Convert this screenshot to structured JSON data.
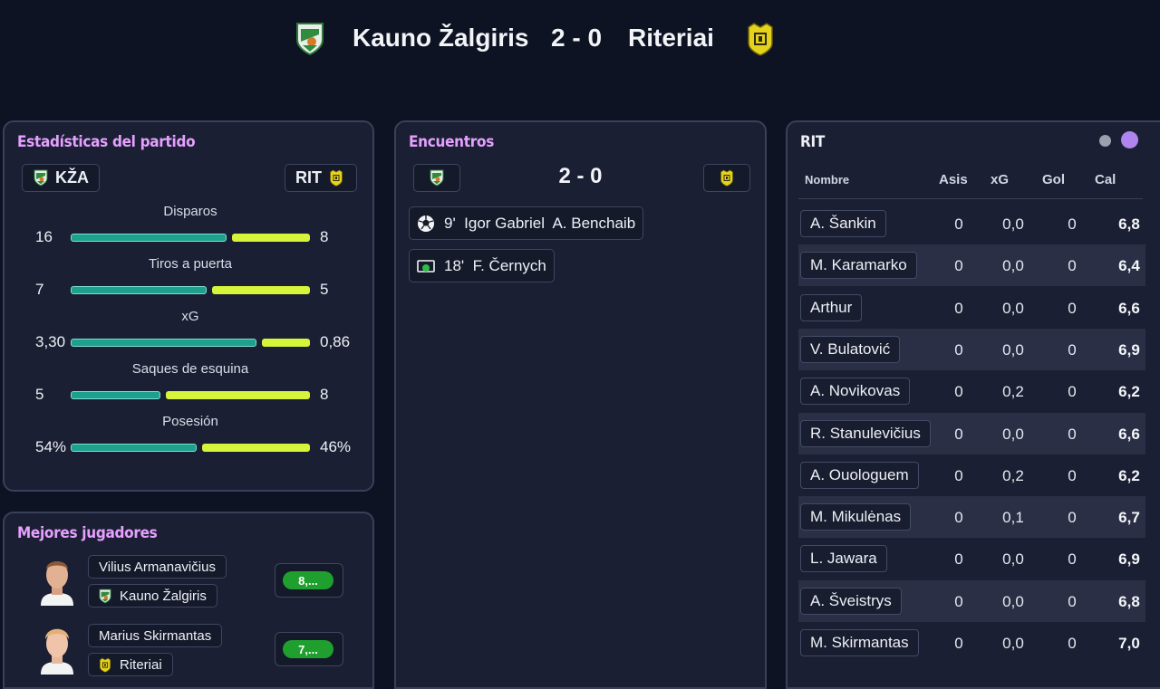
{
  "header": {
    "home_team": "Kauno Žalgiris",
    "score": "2 - 0",
    "away_team": "Riteriai",
    "home_crest_icon": "zalgiris-crest-icon",
    "away_crest_icon": "riteriai-crest-icon"
  },
  "colors": {
    "home": "#1ea08e",
    "away": "#d6f53a",
    "accent_title": "#e6a0ff",
    "rating_green": "#1fa02e",
    "toggle_active": "#b084f0"
  },
  "stats_panel": {
    "title": "Estadísticas del partido",
    "home_abbr": "KŽA",
    "away_abbr": "RIT",
    "stats": [
      {
        "label": "Disparos",
        "home": "16",
        "away": "8",
        "home_share": 0.667
      },
      {
        "label": "Tiros a puerta",
        "home": "7",
        "away": "5",
        "home_share": 0.583
      },
      {
        "label": "xG",
        "home": "3,30",
        "away": "0,86",
        "home_share": 0.793
      },
      {
        "label": "Saques de esquina",
        "home": "5",
        "away": "8",
        "home_share": 0.385
      },
      {
        "label": "Posesión",
        "home": "54%",
        "away": "46%",
        "home_share": 0.54
      }
    ]
  },
  "best_players": {
    "title": "Mejores jugadores",
    "players": [
      {
        "name": "Vilius Armanavičius",
        "team": "Kauno Žalgiris",
        "rating": "8,..."
      },
      {
        "name": "Marius Skirmantas",
        "team": "Riteriai",
        "rating": "7,..."
      }
    ]
  },
  "events_panel": {
    "title": "Encuentros",
    "score": "2 - 0",
    "events": [
      {
        "icon": "soccer-ball-icon",
        "text": "9'  Igor Gabriel  A. Benchaib"
      },
      {
        "icon": "penalty-goal-icon",
        "text": "18'  F. Černych"
      }
    ]
  },
  "lineup_panel": {
    "title": "RIT",
    "columns": {
      "name": "Nombre",
      "assists": "Asis",
      "xg": "xG",
      "goals": "Gol",
      "rating": "Cal"
    },
    "rows": [
      {
        "name": "A. Šankin",
        "assists": "0",
        "xg": "0,0",
        "goals": "0",
        "rating": "6,8"
      },
      {
        "name": "M. Karamarko",
        "assists": "0",
        "xg": "0,0",
        "goals": "0",
        "rating": "6,4"
      },
      {
        "name": "Arthur",
        "assists": "0",
        "xg": "0,0",
        "goals": "0",
        "rating": "6,6"
      },
      {
        "name": "V. Bulatović",
        "assists": "0",
        "xg": "0,0",
        "goals": "0",
        "rating": "6,9"
      },
      {
        "name": "A. Novikovas",
        "assists": "0",
        "xg": "0,2",
        "goals": "0",
        "rating": "6,2"
      },
      {
        "name": "R. Stanulevičius",
        "assists": "0",
        "xg": "0,0",
        "goals": "0",
        "rating": "6,6"
      },
      {
        "name": "A. Ouologuem",
        "assists": "0",
        "xg": "0,2",
        "goals": "0",
        "rating": "6,2"
      },
      {
        "name": "M. Mikulėnas",
        "assists": "0",
        "xg": "0,1",
        "goals": "0",
        "rating": "6,7"
      },
      {
        "name": "L. Jawara",
        "assists": "0",
        "xg": "0,0",
        "goals": "0",
        "rating": "6,9"
      },
      {
        "name": "A. Šveistrys",
        "assists": "0",
        "xg": "0,0",
        "goals": "0",
        "rating": "6,8"
      },
      {
        "name": "M. Skirmantas",
        "assists": "0",
        "xg": "0,0",
        "goals": "0",
        "rating": "7,0"
      }
    ]
  }
}
